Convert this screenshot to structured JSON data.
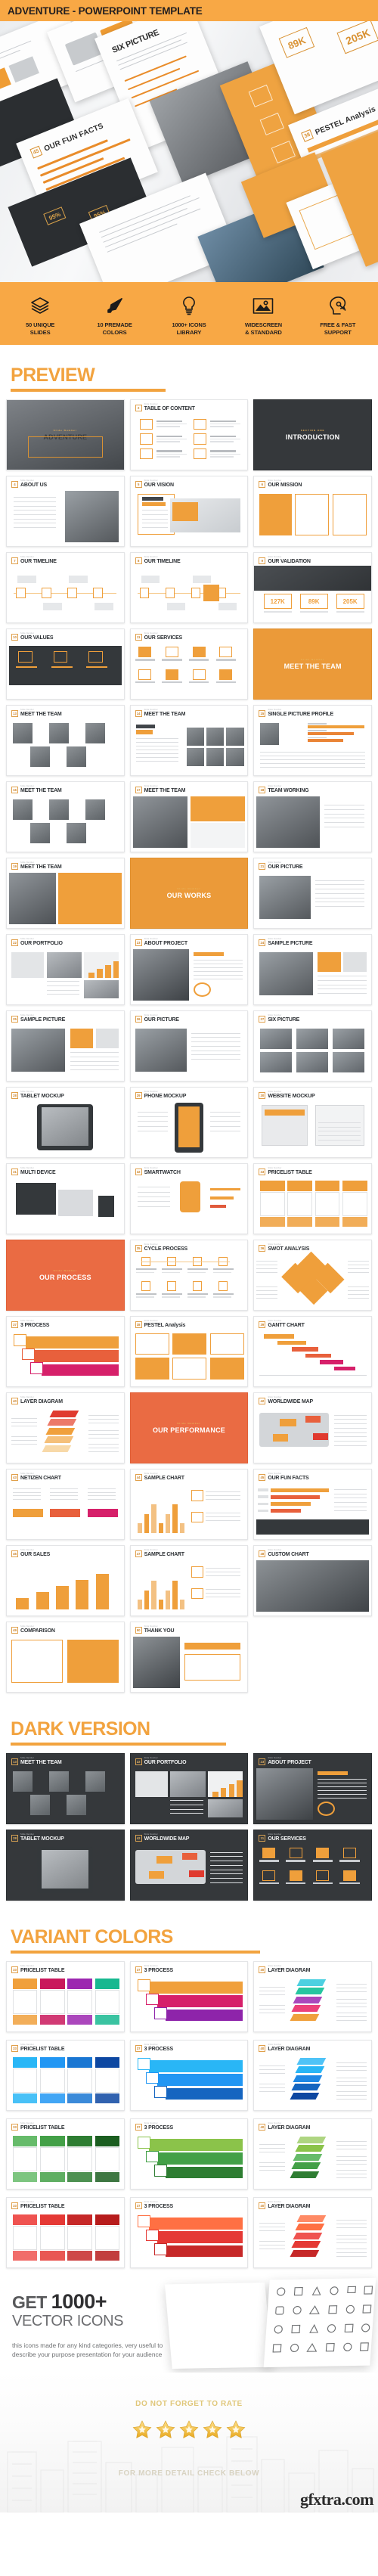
{
  "hero": {
    "title": "ADVENTURE - POWERPOINT TEMPLATE",
    "mock_labels": [
      "ADVENTURE",
      "SIX PICTURE",
      "OUR FUN FACTS",
      "PESTEL Analysis",
      "205K",
      "89K",
      "45",
      "38"
    ]
  },
  "features": [
    {
      "icon": "layers-icon",
      "line1": "50 UNIQUE",
      "line2": "SLIDES"
    },
    {
      "icon": "brush-icon",
      "line1": "10 PREMADE",
      "line2": "COLORS"
    },
    {
      "icon": "lightbulb-icon",
      "line1": "1000+ ICONS",
      "line2": "LIBRARY"
    },
    {
      "icon": "image-icon",
      "line1": "WIDESCREEN",
      "line2": "& STANDARD"
    },
    {
      "icon": "brain-head-icon",
      "line1": "FREE & FAST",
      "line2": "SUPPORT"
    }
  ],
  "sections": {
    "preview": "PREVIEW",
    "dark": "DARK VERSION",
    "variant": "VARIANT COLORS"
  },
  "slide_kicker": "Slide Number",
  "preview_slides": [
    {
      "num": "",
      "title": "ADVENTURE",
      "kind": "cover-photo"
    },
    {
      "num": "2",
      "title": "TABLE OF CONTENT",
      "kind": "toc"
    },
    {
      "num": "3",
      "title": "INTRODUCTION",
      "kind": "dark-cover",
      "kicker": "SECTION ONE"
    },
    {
      "num": "4",
      "title": "ABOUT US",
      "kind": "text-photo"
    },
    {
      "num": "5",
      "title": "OUR VISION",
      "kind": "vision"
    },
    {
      "num": "6",
      "title": "OUR MISSION",
      "kind": "mission"
    },
    {
      "num": "7",
      "title": "OUR TIMELINE",
      "kind": "timeline"
    },
    {
      "num": "8",
      "title": "OUR TIMELINE",
      "kind": "timeline2"
    },
    {
      "num": "9",
      "title": "OUR VALIDATION",
      "kind": "validation",
      "stats": [
        "127K",
        "89K",
        "205K"
      ]
    },
    {
      "num": "10",
      "title": "OUR VALUES",
      "kind": "values"
    },
    {
      "num": "11",
      "title": "OUR SERVICES",
      "kind": "services"
    },
    {
      "num": "12",
      "title": "MEET THE TEAM",
      "kind": "orange-cover"
    },
    {
      "num": "13",
      "title": "MEET THE TEAM",
      "kind": "team-grid"
    },
    {
      "num": "14",
      "title": "MEET THE TEAM",
      "kind": "team-photos"
    },
    {
      "num": "15",
      "title": "SINGLE PICTURE PROFILE",
      "kind": "profile"
    },
    {
      "num": "16",
      "title": "MEET THE TEAM",
      "kind": "team-grid2"
    },
    {
      "num": "17",
      "title": "MEET THE TEAM",
      "kind": "team-two"
    },
    {
      "num": "18",
      "title": "TEAM WORKING",
      "kind": "team-working"
    },
    {
      "num": "19",
      "title": "MEET THE TEAM",
      "kind": "team-big"
    },
    {
      "num": "20",
      "title": "OUR WORKS",
      "kind": "orange-cover2"
    },
    {
      "num": "21",
      "title": "OUR PICTURE",
      "kind": "picture"
    },
    {
      "num": "22",
      "title": "OUR PORTFOLIO",
      "kind": "portfolio"
    },
    {
      "num": "23",
      "title": "ABOUT PROJECT",
      "kind": "about-project"
    },
    {
      "num": "24",
      "title": "SAMPLE PICTURE",
      "kind": "sample-picture"
    },
    {
      "num": "25",
      "title": "SAMPLE PICTURE",
      "kind": "sample-picture2"
    },
    {
      "num": "26",
      "title": "OUR PICTURE",
      "kind": "picture2"
    },
    {
      "num": "27",
      "title": "SIX PICTURE",
      "kind": "six-picture"
    },
    {
      "num": "28",
      "title": "TABLET MOCKUP",
      "kind": "tablet"
    },
    {
      "num": "29",
      "title": "PHONE MOCKUP",
      "kind": "phone"
    },
    {
      "num": "30",
      "title": "WEBSITE MOCKUP",
      "kind": "website"
    },
    {
      "num": "31",
      "title": "MULTI DEVICE",
      "kind": "multidevice"
    },
    {
      "num": "32",
      "title": "SMARTWATCH",
      "kind": "smartwatch"
    },
    {
      "num": "33",
      "title": "PRICELIST TABLE",
      "kind": "pricelist"
    },
    {
      "num": "34",
      "title": "OUR PROCESS",
      "kind": "deep-orange-cover"
    },
    {
      "num": "35",
      "title": "CYCLE PROCESS",
      "kind": "cycle"
    },
    {
      "num": "36",
      "title": "SWOT ANALYSIS",
      "kind": "swot"
    },
    {
      "num": "37",
      "title": "3 PROCESS",
      "kind": "process3"
    },
    {
      "num": "38",
      "title": "PESTEL Analysis",
      "kind": "pestel"
    },
    {
      "num": "39",
      "title": "GANTT CHART",
      "kind": "gantt"
    },
    {
      "num": "40",
      "title": "LAYER DIAGRAM",
      "kind": "layer"
    },
    {
      "num": "41",
      "title": "OUR PERFORMANCE",
      "kind": "deep-orange-cover2"
    },
    {
      "num": "42",
      "title": "WORLDWIDE MAP",
      "kind": "worldmap"
    },
    {
      "num": "43",
      "title": "NETIZEN CHART",
      "kind": "netizen"
    },
    {
      "num": "44",
      "title": "SAMPLE CHART",
      "kind": "samplechart"
    },
    {
      "num": "45",
      "title": "OUR FUN FACTS",
      "kind": "funfacts"
    },
    {
      "num": "46",
      "title": "OUR SALES",
      "kind": "sales"
    },
    {
      "num": "47",
      "title": "SAMPLE CHART",
      "kind": "samplechart2"
    },
    {
      "num": "48",
      "title": "CUSTOM CHART",
      "kind": "customchart"
    },
    {
      "num": "49",
      "title": "COMPARISON",
      "kind": "comparison"
    },
    {
      "num": "50",
      "title": "THANK YOU",
      "kind": "thankyou"
    }
  ],
  "dark_slides": [
    {
      "num": "13",
      "title": "MEET THE TEAM",
      "kind": "team-grid"
    },
    {
      "num": "22",
      "title": "OUR PORTFOLIO",
      "kind": "portfolio"
    },
    {
      "num": "23",
      "title": "ABOUT PROJECT",
      "kind": "about-project"
    },
    {
      "num": "28",
      "title": "TABLET MOCKUP",
      "kind": "tablet"
    },
    {
      "num": "42",
      "title": "WORLDWIDE MAP",
      "kind": "worldmap"
    },
    {
      "num": "11",
      "title": "OUR SERVICES",
      "kind": "services"
    }
  ],
  "variant_rows": [
    {
      "accent": "#f0a03c",
      "slides": [
        {
          "num": "33",
          "title": "PRICELIST TABLE",
          "kind": "pricelist",
          "colors": [
            "#f0a03c",
            "#c9185c",
            "#9c27b0",
            "#17b890"
          ]
        },
        {
          "num": "37",
          "title": "3 PROCESS",
          "kind": "process3",
          "colors": [
            "#f0a03c",
            "#d6206a",
            "#8e24aa"
          ]
        },
        {
          "num": "40",
          "title": "LAYER DIAGRAM",
          "kind": "layer",
          "colors": [
            "#4dd0e1",
            "#26c6a0",
            "#ab47bc",
            "#ec407a",
            "#f0a03c"
          ]
        }
      ]
    },
    {
      "accent": "#2196f3",
      "slides": [
        {
          "num": "33",
          "title": "PRICELIST TABLE",
          "kind": "pricelist",
          "colors": [
            "#29b6f6",
            "#2196f3",
            "#1976d2",
            "#0d47a1"
          ]
        },
        {
          "num": "37",
          "title": "3 PROCESS",
          "kind": "process3",
          "colors": [
            "#29b6f6",
            "#2196f3",
            "#1565c0"
          ]
        },
        {
          "num": "40",
          "title": "LAYER DIAGRAM",
          "kind": "layer",
          "colors": [
            "#4fc3f7",
            "#29b6f6",
            "#1e88e5",
            "#1565c0",
            "#0d47a1"
          ]
        }
      ]
    },
    {
      "accent": "#43a047",
      "slides": [
        {
          "num": "33",
          "title": "PRICELIST TABLE",
          "kind": "pricelist",
          "colors": [
            "#66bb6a",
            "#43a047",
            "#2e7d32",
            "#1b5e20"
          ]
        },
        {
          "num": "37",
          "title": "3 PROCESS",
          "kind": "process3",
          "colors": [
            "#8bc34a",
            "#43a047",
            "#2e7d32"
          ]
        },
        {
          "num": "40",
          "title": "LAYER DIAGRAM",
          "kind": "layer",
          "colors": [
            "#aed581",
            "#8bc34a",
            "#66bb6a",
            "#43a047",
            "#2e7d32"
          ]
        }
      ]
    },
    {
      "accent": "#e53935",
      "slides": [
        {
          "num": "33",
          "title": "PRICELIST TABLE",
          "kind": "pricelist",
          "colors": [
            "#ef5350",
            "#e53935",
            "#c62828",
            "#b71c1c"
          ]
        },
        {
          "num": "37",
          "title": "3 PROCESS",
          "kind": "process3",
          "colors": [
            "#ff7043",
            "#e53935",
            "#c62828"
          ]
        },
        {
          "num": "40",
          "title": "LAYER DIAGRAM",
          "kind": "layer",
          "colors": [
            "#ff8a65",
            "#ff7043",
            "#ef5350",
            "#e53935",
            "#c62828"
          ]
        }
      ]
    }
  ],
  "icons_section": {
    "get": "GET",
    "count": "1000+",
    "vector": "VECTOR ICONS",
    "blurb": "this icons made for any kind categories, very useful to describe your purpose presentation for your audience"
  },
  "rating": {
    "top_text": "DO NOT FORGET TO RATE",
    "stars": 5,
    "bottom_text": "FOR MORE DETAIL CHECK BELOW",
    "watermark": "gfxtra.com"
  },
  "colors": {
    "brand_orange": "#f8a845",
    "heading_orange": "#f2a33f",
    "dark": "#35383b",
    "deep_orange": "#ea6b43"
  }
}
